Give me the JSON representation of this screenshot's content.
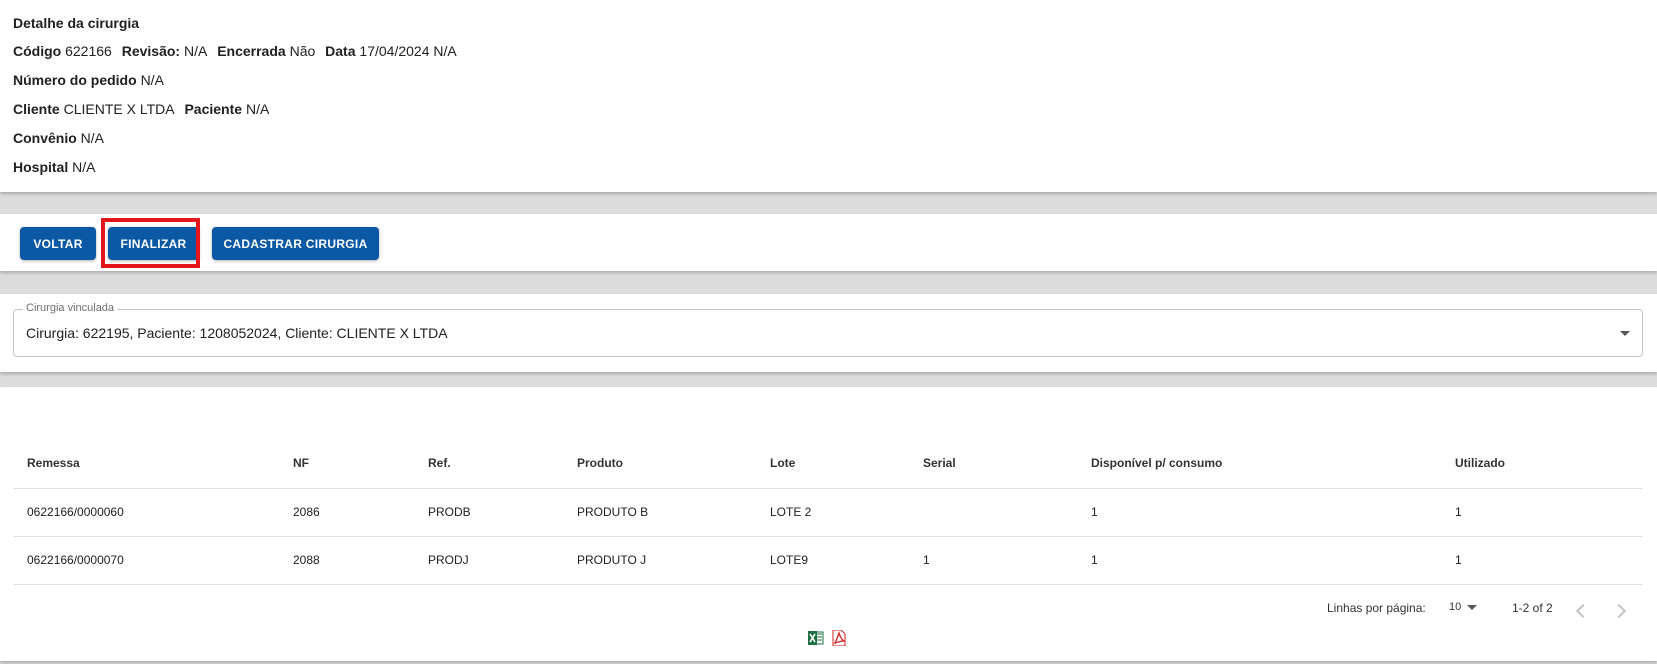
{
  "detail": {
    "title": "Detalhe da cirurgia",
    "codigo_label": "Código",
    "codigo": "622166",
    "revisao_label": "Revisão:",
    "revisao": "N/A",
    "encerrada_label": "Encerrada",
    "encerrada": "Não",
    "data_label": "Data",
    "data": "17/04/2024 N/A",
    "pedido_label": "Número do pedido",
    "pedido": "N/A",
    "cliente_label": "Cliente",
    "cliente": "CLIENTE X LTDA",
    "paciente_label": "Paciente",
    "paciente": "N/A",
    "convenio_label": "Convênio",
    "convenio": "N/A",
    "hospital_label": "Hospital",
    "hospital": "N/A"
  },
  "actions": {
    "voltar": "VOLTAR",
    "finalizar": "FINALIZAR",
    "cadastrar": "CADASTRAR CIRURGIA"
  },
  "linked": {
    "label": "Cirurgia vinculada",
    "value": "Cirurgia: 622195, Paciente: 1208052024, Cliente: CLIENTE X LTDA"
  },
  "table": {
    "headers": [
      "Remessa",
      "NF",
      "Ref.",
      "Produto",
      "Lote",
      "Serial",
      "Disponível p/ consumo",
      "Utilizado"
    ],
    "rows": [
      [
        "0622166/0000060",
        "2086",
        "PRODB",
        "PRODUTO B",
        "LOTE 2",
        "",
        "1",
        "1"
      ],
      [
        "0622166/0000070",
        "2088",
        "PRODJ",
        "PRODUTO J",
        "LOTE9",
        "1",
        "1",
        "1"
      ]
    ]
  },
  "pagination": {
    "rows_per_page_label": "Linhas por página:",
    "rows_per_page": "10",
    "range": "1-2 of 2"
  },
  "icons": {
    "excel": "excel-export-icon",
    "pdf": "pdf-export-icon"
  },
  "colors": {
    "primary": "#0b58a5",
    "highlight": "#e5161b",
    "excel": "#1d7044",
    "pdf": "#d6201f"
  }
}
